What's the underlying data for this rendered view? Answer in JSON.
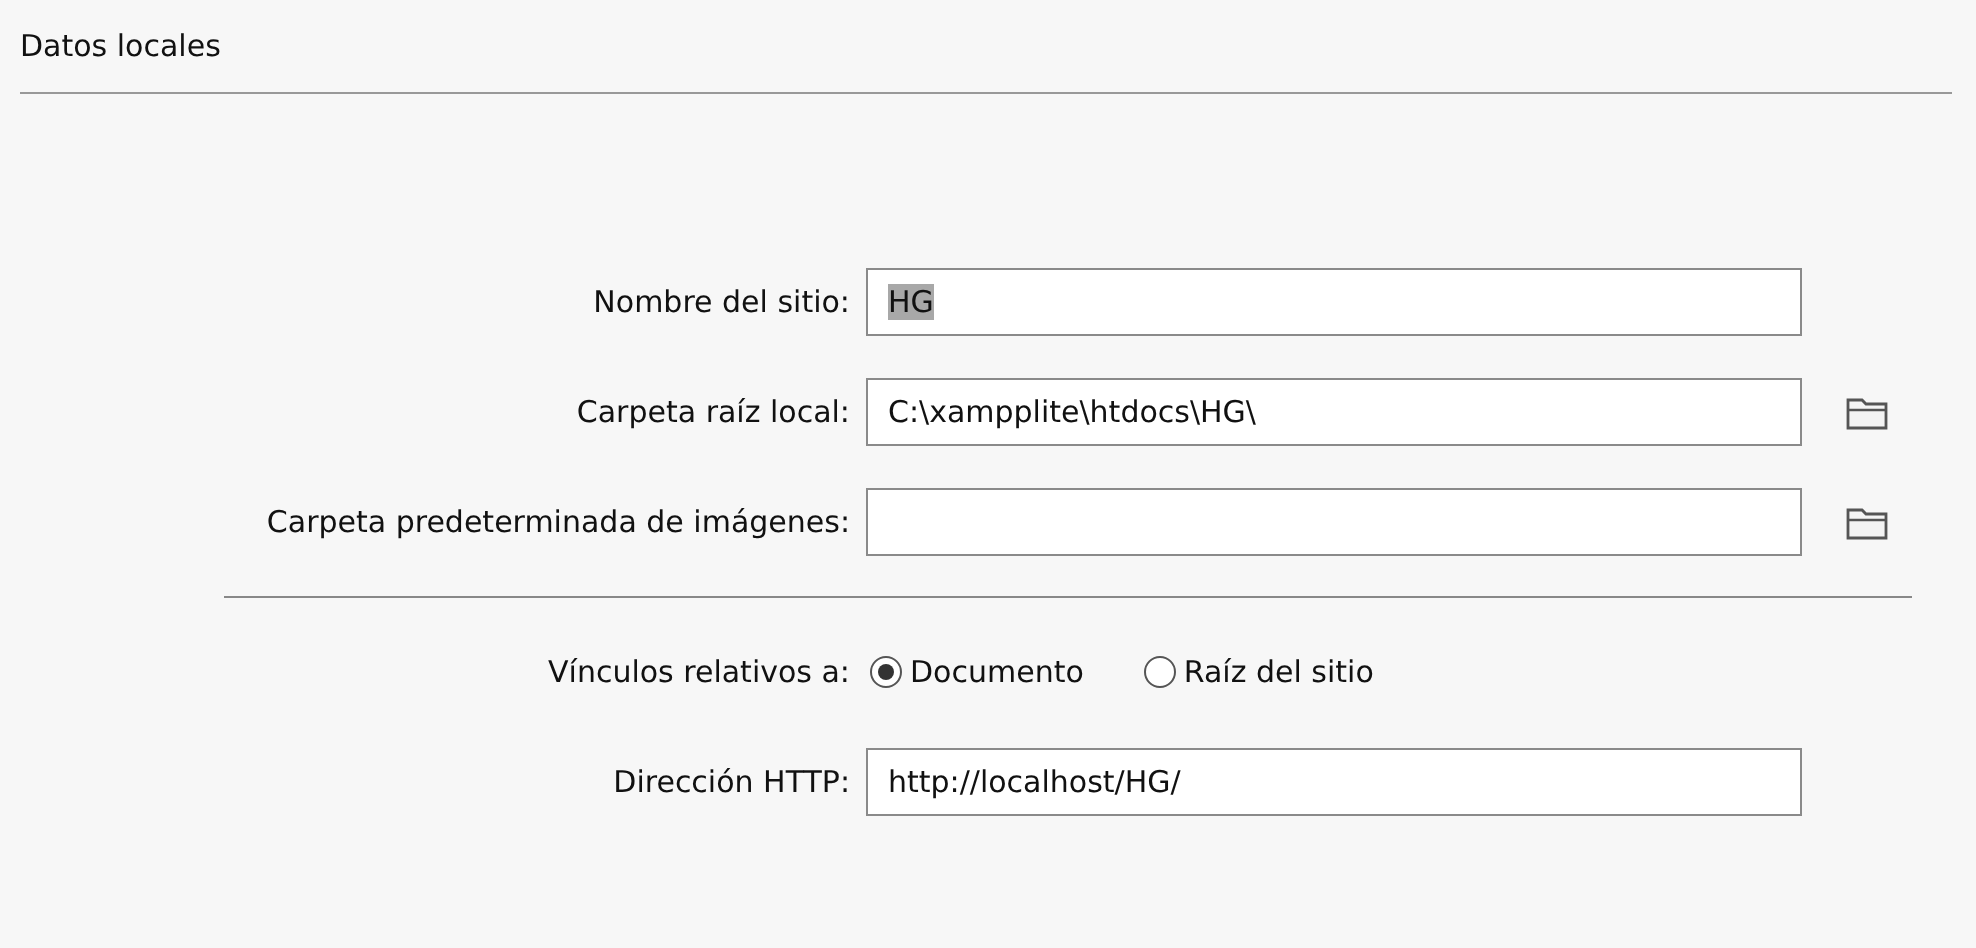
{
  "section": {
    "title": "Datos locales"
  },
  "fields": [
    {
      "label": "Nombre del sitio:",
      "value": "HG",
      "highlighted": true,
      "browse": false
    },
    {
      "label": "Carpeta raíz local:",
      "value": "C:\\xampplite\\htdocs\\HG\\",
      "highlighted": false,
      "browse": true
    },
    {
      "label": "Carpeta predeterminada de imágenes:",
      "browse": true
    }
  ],
  "links_relative": {
    "label": "Vínculos relativos a:",
    "options": [
      {
        "label": "Documento",
        "selected": true
      },
      {
        "label": "Raíz del sitio",
        "selected": false
      }
    ]
  },
  "http_address": {
    "label": "Dirección HTTP:",
    "value": "http://localhost/HG/"
  }
}
